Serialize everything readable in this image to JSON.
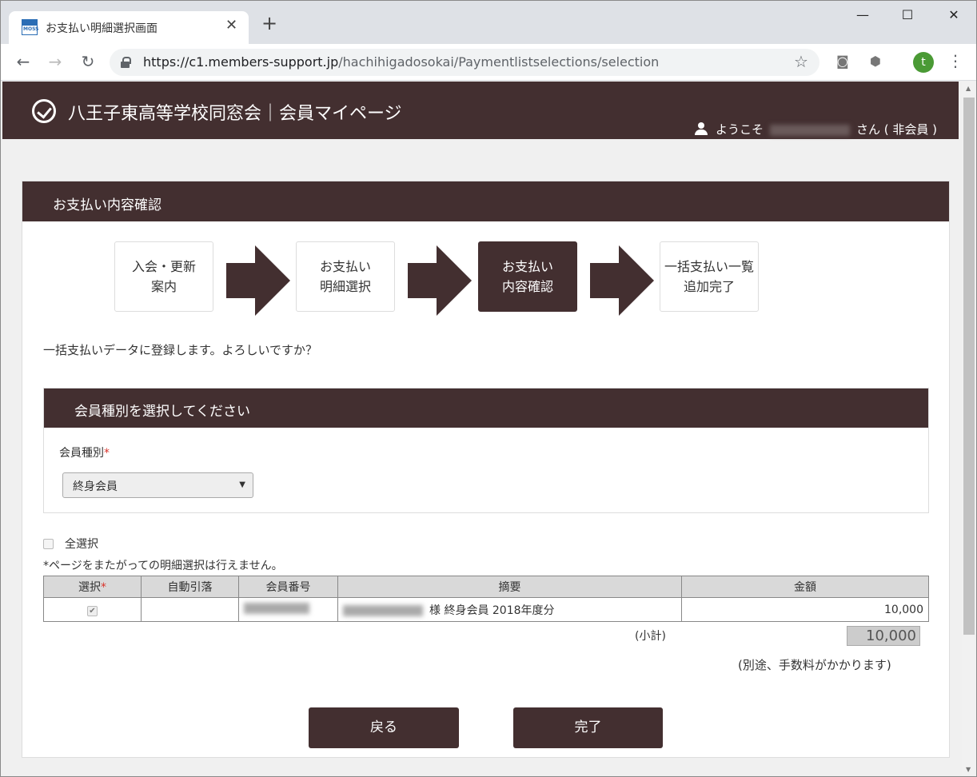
{
  "browser": {
    "tab_title": "お支払い明細選択画面",
    "favicon_text": "MOSS",
    "url_host": "https://c1.members-support.jp",
    "url_path": "/hachihigadosokai/Paymentlistselections/selection",
    "profile_initial": "t"
  },
  "header": {
    "site_title": "八王子東高等学校同窓会｜会員マイページ",
    "welcome_prefix": "ようこそ",
    "welcome_suffix": "さん ( 非会員 )"
  },
  "panel": {
    "title": "お支払い内容確認"
  },
  "steps": [
    {
      "label": "入会・更新\n案内",
      "active": false
    },
    {
      "label": "お支払い\n明細選択",
      "active": false
    },
    {
      "label": "お支払い\n内容確認",
      "active": true
    },
    {
      "label": "一括支払い一覧\n追加完了",
      "active": false
    }
  ],
  "confirm_message": "一括支払いデータに登録します。よろしいですか？",
  "member_type": {
    "section_title": "会員種別を選択してください",
    "label": "会員種別",
    "required_mark": "*",
    "selected": "終身会員"
  },
  "select_all_label": "全選択",
  "note": "*ページをまたがっての明細選択は行えません。",
  "table": {
    "headers": {
      "select": "選択",
      "auto_debit": "自動引落",
      "member_no": "会員番号",
      "summary": "摘要",
      "amount": "金額"
    },
    "rows": [
      {
        "summary_suffix": "様 終身会員 2018年度分",
        "amount": "10,000",
        "checked": true
      }
    ]
  },
  "subtotal": {
    "label": "(小計)",
    "value": "10,000"
  },
  "fee_note": "(別途、手数料がかかります)",
  "buttons": {
    "back": "戻る",
    "complete": "完了"
  }
}
